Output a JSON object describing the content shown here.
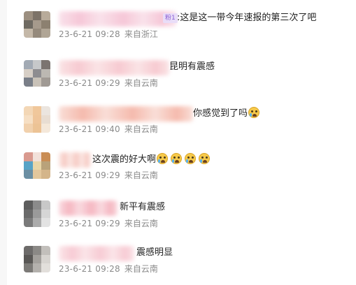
{
  "comments": [
    {
      "text": ":这是这一带今年速报的第三次了吧",
      "badge": "粉1",
      "date": "23-6-21 09:28",
      "location": "来自浙江",
      "emoji_count": 0,
      "avatar_colors": [
        "#9c8f80",
        "#7d7368",
        "#b8ab9a",
        "#6f6a62",
        "#a69a8c",
        "#8c8070",
        "#c4b8a8",
        "#958a7c",
        "#b0a595"
      ],
      "name_blur_colors": [
        "#f6c5d6",
        "#f9e1ea"
      ]
    },
    {
      "text": "昆明有震感",
      "badge": "",
      "date": "23-6-21 09:29",
      "location": "来自云南",
      "emoji_count": 0,
      "avatar_colors": [
        "#a2aab4",
        "#c6c8ca",
        "#7b7470",
        "#d7cfc6",
        "#8e8d90",
        "#bcb8b2",
        "#7a7f88",
        "#c9c2b8",
        "#a09a94"
      ],
      "name_blur_colors": [
        "#f7c8cf",
        "#fae3e5"
      ]
    },
    {
      "text": "你感觉到了吗",
      "badge": "",
      "date": "23-6-21 09:40",
      "location": "来自云南",
      "emoji_count": 1,
      "avatar_colors": [
        "#f3d7b6",
        "#f0c79b",
        "#ebe5df",
        "#f6dfc4",
        "#efc59a",
        "#e8ddd2",
        "#f1d1ad",
        "#ecc395",
        "#f4e8da"
      ],
      "name_blur_colors": [
        "#f5b7a9",
        "#f9ddd6"
      ]
    },
    {
      "text": "这次震的好大啊",
      "badge": "",
      "date": "23-6-21 09:29",
      "location": "来自云南",
      "emoji_count": 4,
      "avatar_colors": [
        "#d99a8f",
        "#f2e1da",
        "#c98d55",
        "#57a3c6",
        "#e9d6a7",
        "#b9a27a",
        "#6b8fa3",
        "#e3c79c",
        "#d4b58a"
      ],
      "name_blur_colors": [
        "#f6c7c0",
        "#fbe7e3"
      ]
    },
    {
      "text": "新平有震感",
      "badge": "",
      "date": "23-6-21 09:29",
      "location": "来自云南",
      "emoji_count": 0,
      "avatar_colors": [
        "#5d5d5d",
        "#8b8b8b",
        "#c8c8c8",
        "#6a6a6a",
        "#9a9a9a",
        "#d6d6d6",
        "#7a7a7a",
        "#ababab",
        "#e3e3e3"
      ],
      "name_blur_colors": [
        "#f5b3be",
        "#f9d9df"
      ]
    },
    {
      "text": "震感明显",
      "badge": "",
      "date": "23-6-21 09:28",
      "location": "来自云南",
      "emoji_count": 0,
      "avatar_colors": [
        "#6d6b6a",
        "#8b8986",
        "#c2bfbb",
        "#595755",
        "#a3a09c",
        "#d7d4d0",
        "#7c7a77",
        "#b4b1ad",
        "#e2dfdb"
      ],
      "name_blur_colors": [
        "#f7c9d2",
        "#fbe4e8"
      ]
    }
  ]
}
